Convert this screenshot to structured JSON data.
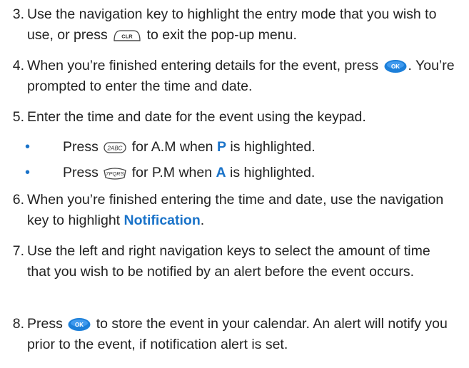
{
  "steps": {
    "s3": {
      "num": "3.",
      "t1": "Use the navigation key to highlight the entry mode that you wish to use, or press",
      "t2": "to exit the pop-up menu."
    },
    "s4": {
      "num": "4.",
      "t1": "When you’re finished entering details for the event, press",
      "t2": ". You’re prompted to enter the time and date."
    },
    "s5": {
      "num": "5.",
      "text": "Enter the time and date for the event using the keypad."
    },
    "b1": {
      "a": "Press",
      "b": "for A.M when",
      "hl": "P",
      "c": "is highlighted."
    },
    "b2": {
      "a": "Press",
      "b": "for P.M when",
      "hl": "A",
      "c": "is highlighted."
    },
    "s6": {
      "num": "6.",
      "t1": "When you’re finished entering the time and date, use the navigation key to highlight",
      "hl": "Notification",
      "t2": "."
    },
    "s7": {
      "num": "7.",
      "text": "Use the left and right navigation keys to select the amount of time that you wish to be notified by an alert before the event occurs."
    },
    "s8": {
      "num": "8.",
      "t1": "Press",
      "t2": "to store the event in your calendar. An alert will notify you prior to the event, if notification alert is set."
    }
  },
  "keys": {
    "clr": "CLR",
    "ok": "OK",
    "two": "2ABC",
    "seven": "7PQRS"
  },
  "colors": {
    "accent": "#1a73c9",
    "text": "#222222"
  }
}
